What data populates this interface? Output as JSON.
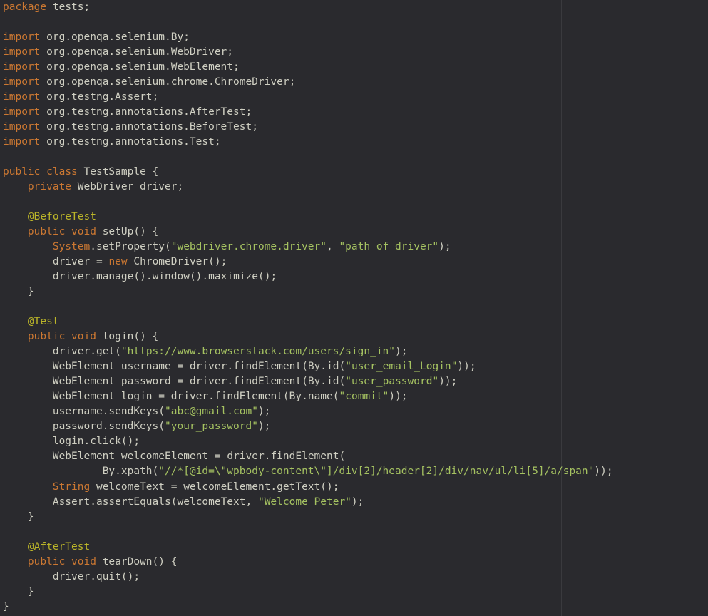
{
  "lines": [
    [
      [
        "kw",
        "package"
      ],
      [
        "punct",
        " "
      ],
      [
        "ident",
        "tests"
      ],
      [
        "punct",
        ";"
      ]
    ],
    [],
    [
      [
        "kw",
        "import"
      ],
      [
        "punct",
        " "
      ],
      [
        "ident",
        "org.openqa.selenium.By"
      ],
      [
        "punct",
        ";"
      ]
    ],
    [
      [
        "kw",
        "import"
      ],
      [
        "punct",
        " "
      ],
      [
        "ident",
        "org.openqa.selenium.WebDriver"
      ],
      [
        "punct",
        ";"
      ]
    ],
    [
      [
        "kw",
        "import"
      ],
      [
        "punct",
        " "
      ],
      [
        "ident",
        "org.openqa.selenium.WebElement"
      ],
      [
        "punct",
        ";"
      ]
    ],
    [
      [
        "kw",
        "import"
      ],
      [
        "punct",
        " "
      ],
      [
        "ident",
        "org.openqa.selenium.chrome.ChromeDriver"
      ],
      [
        "punct",
        ";"
      ]
    ],
    [
      [
        "kw",
        "import"
      ],
      [
        "punct",
        " "
      ],
      [
        "ident",
        "org.testng.Assert"
      ],
      [
        "punct",
        ";"
      ]
    ],
    [
      [
        "kw",
        "import"
      ],
      [
        "punct",
        " "
      ],
      [
        "ident",
        "org.testng.annotations.AfterTest"
      ],
      [
        "punct",
        ";"
      ]
    ],
    [
      [
        "kw",
        "import"
      ],
      [
        "punct",
        " "
      ],
      [
        "ident",
        "org.testng.annotations.BeforeTest"
      ],
      [
        "punct",
        ";"
      ]
    ],
    [
      [
        "kw",
        "import"
      ],
      [
        "punct",
        " "
      ],
      [
        "ident",
        "org.testng.annotations.Test"
      ],
      [
        "punct",
        ";"
      ]
    ],
    [],
    [
      [
        "kw",
        "public"
      ],
      [
        "punct",
        " "
      ],
      [
        "kw",
        "class"
      ],
      [
        "punct",
        " "
      ],
      [
        "type",
        "TestSample"
      ],
      [
        "punct",
        " {"
      ]
    ],
    [
      [
        "punct",
        "    "
      ],
      [
        "kw",
        "private"
      ],
      [
        "punct",
        " "
      ],
      [
        "type",
        "WebDriver"
      ],
      [
        "punct",
        " "
      ],
      [
        "ident",
        "driver"
      ],
      [
        "punct",
        ";"
      ]
    ],
    [],
    [
      [
        "punct",
        "    "
      ],
      [
        "annot",
        "@BeforeTest"
      ]
    ],
    [
      [
        "punct",
        "    "
      ],
      [
        "kw",
        "public"
      ],
      [
        "punct",
        " "
      ],
      [
        "kw",
        "void"
      ],
      [
        "punct",
        " "
      ],
      [
        "method",
        "setUp"
      ],
      [
        "punct",
        "() {"
      ]
    ],
    [
      [
        "punct",
        "        "
      ],
      [
        "sys",
        "System"
      ],
      [
        "punct",
        "."
      ],
      [
        "method",
        "setProperty"
      ],
      [
        "punct",
        "("
      ],
      [
        "string",
        "\"webdriver.chrome.driver\""
      ],
      [
        "punct",
        ", "
      ],
      [
        "string",
        "\"path of driver\""
      ],
      [
        "punct",
        ");"
      ]
    ],
    [
      [
        "punct",
        "        "
      ],
      [
        "ident",
        "driver"
      ],
      [
        "punct",
        " = "
      ],
      [
        "kw",
        "new"
      ],
      [
        "punct",
        " "
      ],
      [
        "type",
        "ChromeDriver"
      ],
      [
        "punct",
        "();"
      ]
    ],
    [
      [
        "punct",
        "        "
      ],
      [
        "ident",
        "driver"
      ],
      [
        "punct",
        "."
      ],
      [
        "method",
        "manage"
      ],
      [
        "punct",
        "()."
      ],
      [
        "method",
        "window"
      ],
      [
        "punct",
        "()."
      ],
      [
        "method",
        "maximize"
      ],
      [
        "punct",
        "();"
      ]
    ],
    [
      [
        "punct",
        "    }"
      ]
    ],
    [],
    [
      [
        "punct",
        "    "
      ],
      [
        "annot",
        "@Test"
      ]
    ],
    [
      [
        "punct",
        "    "
      ],
      [
        "kw",
        "public"
      ],
      [
        "punct",
        " "
      ],
      [
        "kw",
        "void"
      ],
      [
        "punct",
        " "
      ],
      [
        "method",
        "login"
      ],
      [
        "punct",
        "() {"
      ]
    ],
    [
      [
        "punct",
        "        "
      ],
      [
        "ident",
        "driver"
      ],
      [
        "punct",
        "."
      ],
      [
        "method",
        "get"
      ],
      [
        "punct",
        "("
      ],
      [
        "string",
        "\"https://www.browserstack.com/users/sign_in\""
      ],
      [
        "punct",
        ");"
      ]
    ],
    [
      [
        "punct",
        "        "
      ],
      [
        "type",
        "WebElement"
      ],
      [
        "punct",
        " "
      ],
      [
        "ident",
        "username"
      ],
      [
        "punct",
        " = "
      ],
      [
        "ident",
        "driver"
      ],
      [
        "punct",
        "."
      ],
      [
        "method",
        "findElement"
      ],
      [
        "punct",
        "("
      ],
      [
        "type",
        "By"
      ],
      [
        "punct",
        "."
      ],
      [
        "method",
        "id"
      ],
      [
        "punct",
        "("
      ],
      [
        "string",
        "\"user_email_Login\""
      ],
      [
        "punct",
        "));"
      ]
    ],
    [
      [
        "punct",
        "        "
      ],
      [
        "type",
        "WebElement"
      ],
      [
        "punct",
        " "
      ],
      [
        "ident",
        "password"
      ],
      [
        "punct",
        " = "
      ],
      [
        "ident",
        "driver"
      ],
      [
        "punct",
        "."
      ],
      [
        "method",
        "findElement"
      ],
      [
        "punct",
        "("
      ],
      [
        "type",
        "By"
      ],
      [
        "punct",
        "."
      ],
      [
        "method",
        "id"
      ],
      [
        "punct",
        "("
      ],
      [
        "string",
        "\"user_password\""
      ],
      [
        "punct",
        "));"
      ]
    ],
    [
      [
        "punct",
        "        "
      ],
      [
        "type",
        "WebElement"
      ],
      [
        "punct",
        " "
      ],
      [
        "ident",
        "login"
      ],
      [
        "punct",
        " = "
      ],
      [
        "ident",
        "driver"
      ],
      [
        "punct",
        "."
      ],
      [
        "method",
        "findElement"
      ],
      [
        "punct",
        "("
      ],
      [
        "type",
        "By"
      ],
      [
        "punct",
        "."
      ],
      [
        "method",
        "name"
      ],
      [
        "punct",
        "("
      ],
      [
        "string",
        "\"commit\""
      ],
      [
        "punct",
        "));"
      ]
    ],
    [
      [
        "punct",
        "        "
      ],
      [
        "ident",
        "username"
      ],
      [
        "punct",
        "."
      ],
      [
        "method",
        "sendKeys"
      ],
      [
        "punct",
        "("
      ],
      [
        "string",
        "\"abc@gmail.com\""
      ],
      [
        "punct",
        ");"
      ]
    ],
    [
      [
        "punct",
        "        "
      ],
      [
        "ident",
        "password"
      ],
      [
        "punct",
        "."
      ],
      [
        "method",
        "sendKeys"
      ],
      [
        "punct",
        "("
      ],
      [
        "string",
        "\"your_password\""
      ],
      [
        "punct",
        ");"
      ]
    ],
    [
      [
        "punct",
        "        "
      ],
      [
        "ident",
        "login"
      ],
      [
        "punct",
        "."
      ],
      [
        "method",
        "click"
      ],
      [
        "punct",
        "();"
      ]
    ],
    [
      [
        "punct",
        "        "
      ],
      [
        "type",
        "WebElement"
      ],
      [
        "punct",
        " "
      ],
      [
        "ident",
        "welcomeElement"
      ],
      [
        "punct",
        " = "
      ],
      [
        "ident",
        "driver"
      ],
      [
        "punct",
        "."
      ],
      [
        "method",
        "findElement"
      ],
      [
        "punct",
        "("
      ]
    ],
    [
      [
        "punct",
        "                "
      ],
      [
        "type",
        "By"
      ],
      [
        "punct",
        "."
      ],
      [
        "method",
        "xpath"
      ],
      [
        "punct",
        "("
      ],
      [
        "string",
        "\"//*[@id=\\\"wpbody-content\\\"]/div[2]/header[2]/div/nav/ul/li[5]/a/span\""
      ],
      [
        "punct",
        "));"
      ]
    ],
    [
      [
        "punct",
        "        "
      ],
      [
        "strtype",
        "String"
      ],
      [
        "punct",
        " "
      ],
      [
        "ident",
        "welcomeText"
      ],
      [
        "punct",
        " = "
      ],
      [
        "ident",
        "welcomeElement"
      ],
      [
        "punct",
        "."
      ],
      [
        "method",
        "getText"
      ],
      [
        "punct",
        "();"
      ]
    ],
    [
      [
        "punct",
        "        "
      ],
      [
        "type",
        "Assert"
      ],
      [
        "punct",
        "."
      ],
      [
        "method",
        "assertEquals"
      ],
      [
        "punct",
        "("
      ],
      [
        "ident",
        "welcomeText"
      ],
      [
        "punct",
        ", "
      ],
      [
        "string",
        "\"Welcome Peter\""
      ],
      [
        "punct",
        ");"
      ]
    ],
    [
      [
        "punct",
        "    }"
      ]
    ],
    [],
    [
      [
        "punct",
        "    "
      ],
      [
        "annot",
        "@AfterTest"
      ]
    ],
    [
      [
        "punct",
        "    "
      ],
      [
        "kw",
        "public"
      ],
      [
        "punct",
        " "
      ],
      [
        "kw",
        "void"
      ],
      [
        "punct",
        " "
      ],
      [
        "method",
        "tearDown"
      ],
      [
        "punct",
        "() {"
      ]
    ],
    [
      [
        "punct",
        "        "
      ],
      [
        "ident",
        "driver"
      ],
      [
        "punct",
        "."
      ],
      [
        "method",
        "quit"
      ],
      [
        "punct",
        "();"
      ]
    ],
    [
      [
        "punct",
        "    }"
      ]
    ],
    [
      [
        "punct",
        "}"
      ]
    ]
  ]
}
